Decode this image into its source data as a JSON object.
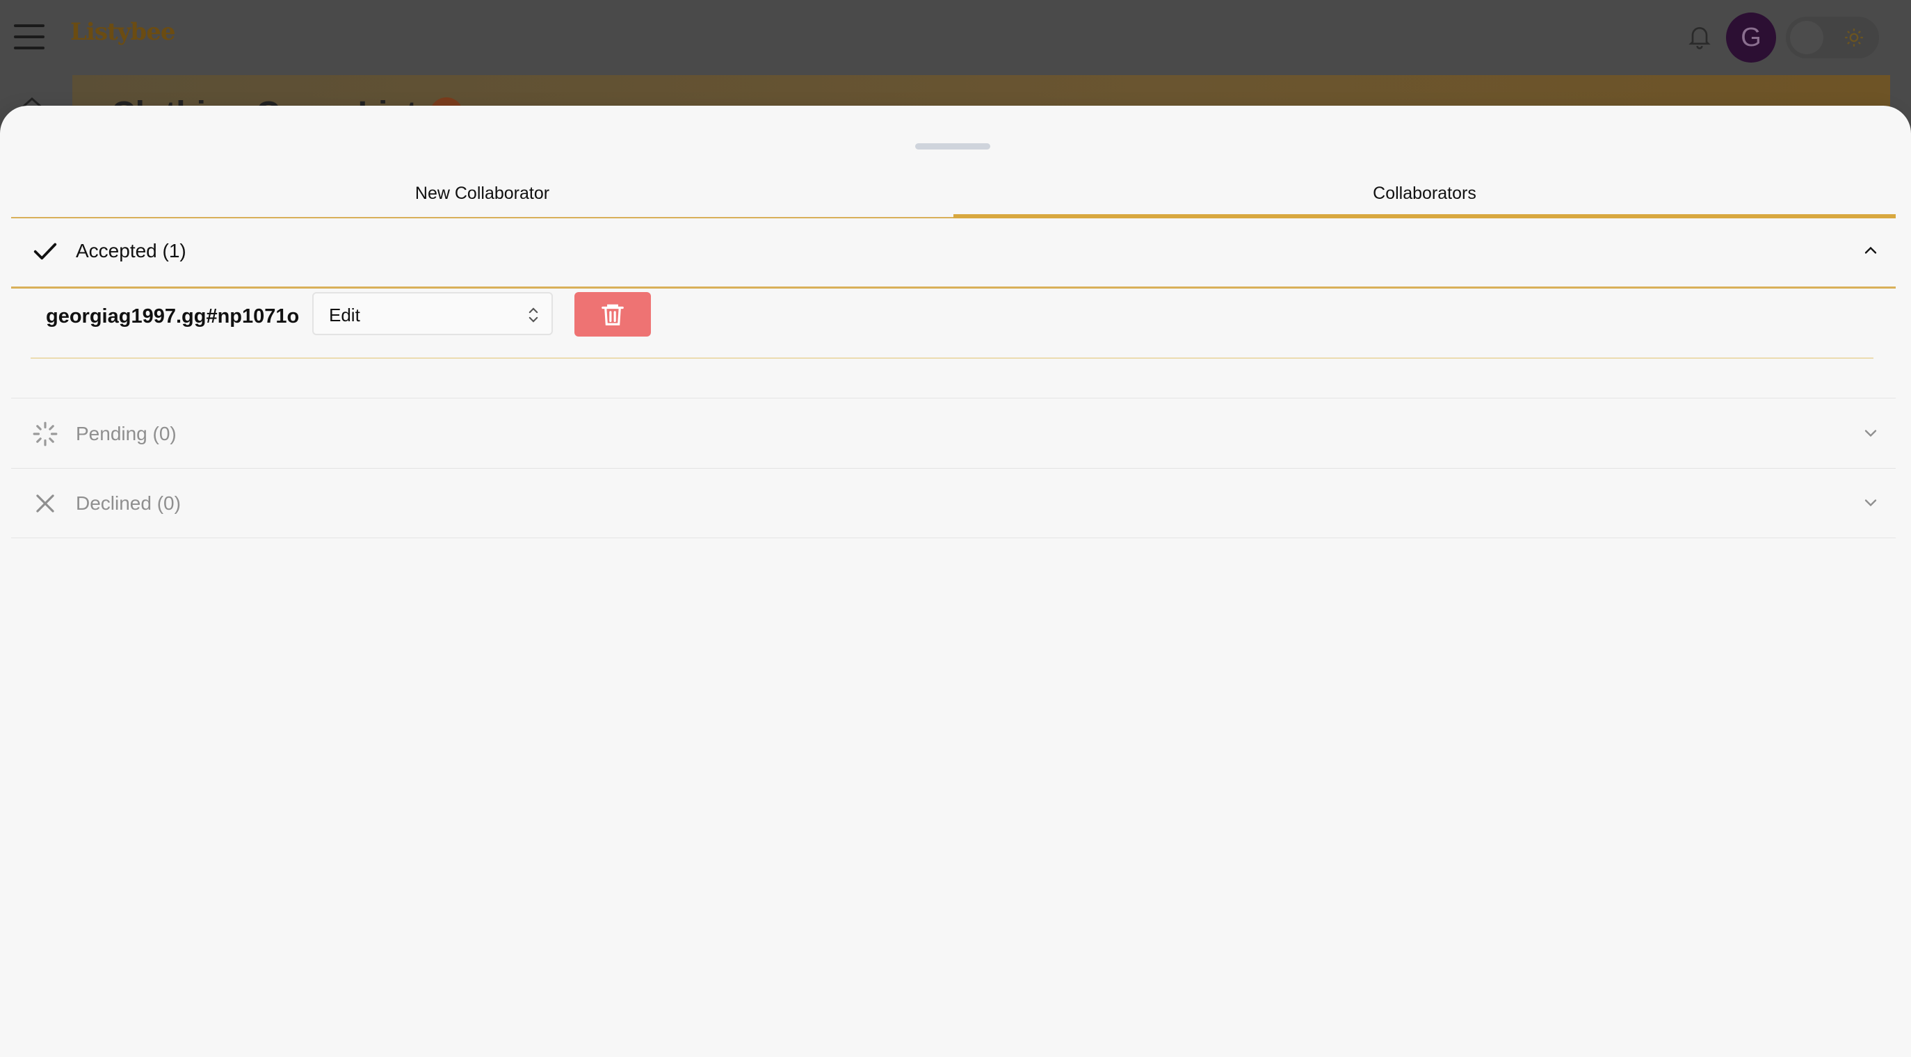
{
  "app": {
    "logo_text": "Listybee",
    "avatar_initial": "G",
    "page_title": "Clothing Camp List"
  },
  "tabs": [
    {
      "label": "New Collaborator",
      "active": false
    },
    {
      "label": "Collaborators",
      "active": true
    }
  ],
  "sections": {
    "accepted": {
      "label": "Accepted (1)",
      "expanded": true,
      "icon": "check-icon"
    },
    "pending": {
      "label": "Pending (0)",
      "expanded": false,
      "icon": "spinner-icon"
    },
    "declined": {
      "label": "Declined (0)",
      "expanded": false,
      "icon": "close-icon"
    }
  },
  "collaborators": [
    {
      "username": "georgiag1997.gg#np1071o",
      "role": "Edit"
    }
  ],
  "colors": {
    "accent": "#d8a840",
    "delete": "#ee7373",
    "avatar_bg": "#2c0f33"
  }
}
